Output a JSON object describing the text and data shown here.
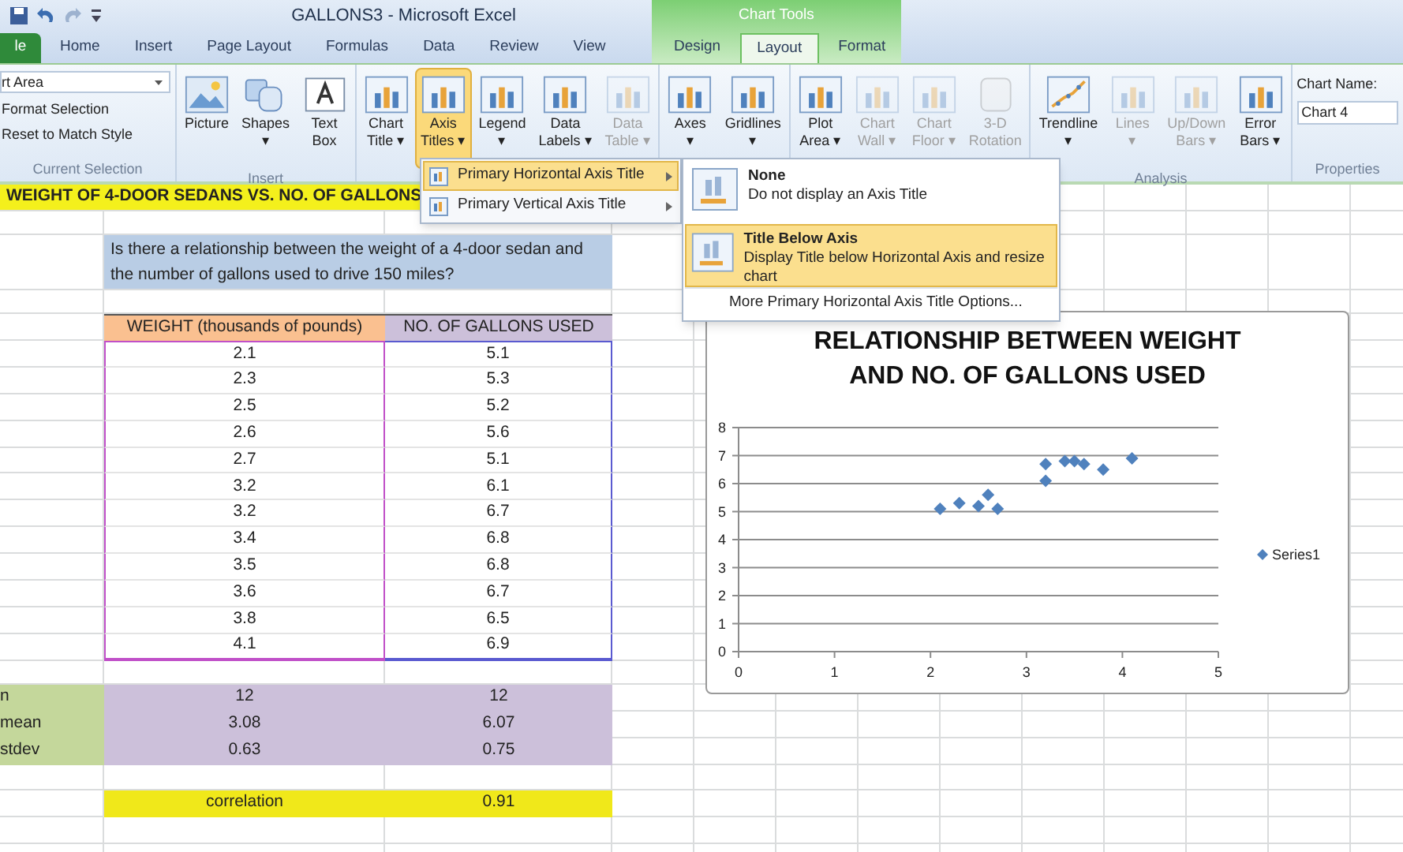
{
  "window": {
    "title": "GALLONS3 - Microsoft Excel",
    "context_header": "Chart Tools"
  },
  "tabs": [
    {
      "label": "le",
      "kind": "file",
      "selected": false
    },
    {
      "label": "Home",
      "kind": "tab",
      "selected": false
    },
    {
      "label": "Insert",
      "kind": "tab",
      "selected": false
    },
    {
      "label": "Page Layout",
      "kind": "tab",
      "selected": false
    },
    {
      "label": "Formulas",
      "kind": "tab",
      "selected": false
    },
    {
      "label": "Data",
      "kind": "tab",
      "selected": false
    },
    {
      "label": "Review",
      "kind": "tab",
      "selected": false
    },
    {
      "label": "View",
      "kind": "tab",
      "selected": false
    },
    {
      "label": "Design",
      "kind": "context",
      "selected": false
    },
    {
      "label": "Layout",
      "kind": "context",
      "selected": true
    },
    {
      "label": "Format",
      "kind": "context",
      "selected": false
    }
  ],
  "current_selection": {
    "field": "rt Area",
    "items": [
      "Format Selection",
      "Reset to Match Style"
    ],
    "label": "Current Selection"
  },
  "groups": [
    {
      "label": "Insert",
      "buttons": [
        {
          "lines": [
            "Picture"
          ],
          "kind": "picture",
          "disabled": false,
          "selected": false
        },
        {
          "lines": [
            "Shapes",
            "▾"
          ],
          "kind": "shapes",
          "disabled": false,
          "selected": false
        },
        {
          "lines": [
            "Text",
            "Box"
          ],
          "kind": "textbox",
          "disabled": false,
          "selected": false
        }
      ]
    },
    {
      "buttons": [
        {
          "lines": [
            "Chart",
            "Title ▾"
          ],
          "kind": "chart",
          "disabled": false,
          "selected": false
        },
        {
          "lines": [
            "Axis",
            "Titles ▾"
          ],
          "kind": "chart",
          "disabled": false,
          "selected": true
        },
        {
          "lines": [
            "Legend",
            "▾"
          ],
          "kind": "chart",
          "disabled": false,
          "selected": false
        },
        {
          "lines": [
            "Data",
            "Labels ▾"
          ],
          "kind": "chart",
          "disabled": false,
          "selected": false
        },
        {
          "lines": [
            "Data",
            "Table ▾"
          ],
          "kind": "chart",
          "disabled": true,
          "selected": false
        }
      ]
    },
    {
      "buttons": [
        {
          "lines": [
            "Axes",
            "▾"
          ],
          "kind": "chart",
          "disabled": false,
          "selected": false
        },
        {
          "lines": [
            "Gridlines",
            "▾"
          ],
          "kind": "chart",
          "disabled": false,
          "selected": false
        }
      ]
    },
    {
      "buttons": [
        {
          "lines": [
            "Plot",
            "Area ▾"
          ],
          "kind": "chart",
          "disabled": false,
          "selected": false
        },
        {
          "lines": [
            "Chart",
            "Wall ▾"
          ],
          "kind": "chart",
          "disabled": true,
          "selected": false
        },
        {
          "lines": [
            "Chart",
            "Floor ▾"
          ],
          "kind": "chart",
          "disabled": true,
          "selected": false
        },
        {
          "lines": [
            "3-D",
            "Rotation"
          ],
          "kind": "cube",
          "disabled": true,
          "selected": false
        }
      ]
    },
    {
      "label": "Analysis",
      "buttons": [
        {
          "lines": [
            "Trendline",
            "▾"
          ],
          "kind": "trend",
          "disabled": false,
          "selected": false
        },
        {
          "lines": [
            "Lines",
            "▾"
          ],
          "kind": "chart",
          "disabled": true,
          "selected": false
        },
        {
          "lines": [
            "Up/Down",
            "Bars ▾"
          ],
          "kind": "chart",
          "disabled": true,
          "selected": false
        },
        {
          "lines": [
            "Error",
            "Bars ▾"
          ],
          "kind": "chart",
          "disabled": false,
          "selected": false
        }
      ]
    }
  ],
  "properties": {
    "label": "Properties",
    "name_label": "Chart Name:",
    "name_value": "Chart 4"
  },
  "menu": {
    "items": [
      {
        "label": "Primary Horizontal Axis Title",
        "selected": true
      },
      {
        "label": "Primary Vertical Axis Title",
        "selected": false
      }
    ]
  },
  "submenu": {
    "items": [
      {
        "title": "None",
        "description": "Do not display an Axis Title",
        "selected": false
      },
      {
        "title": "Title Below Axis",
        "description": "Display Title below Horizontal Axis and resize chart",
        "selected": true
      }
    ],
    "more": "More Primary Horizontal Axis Title Options..."
  },
  "sheet": {
    "banner": "WEIGHT OF 4-DOOR SEDANS VS. NO. OF GALLONS",
    "question": "Is there a relationship between the weight of a 4-door sedan and the number of gallons used to drive 150 miles?",
    "columns": [
      "WEIGHT (thousands of pounds)",
      "NO. OF GALLONS USED"
    ],
    "rows": [
      {
        "weight": "2.1",
        "gallons": "5.1"
      },
      {
        "weight": "2.3",
        "gallons": "5.3"
      },
      {
        "weight": "2.5",
        "gallons": "5.2"
      },
      {
        "weight": "2.6",
        "gallons": "5.6"
      },
      {
        "weight": "2.7",
        "gallons": "5.1"
      },
      {
        "weight": "3.2",
        "gallons": "6.1"
      },
      {
        "weight": "3.2",
        "gallons": "6.7"
      },
      {
        "weight": "3.4",
        "gallons": "6.8"
      },
      {
        "weight": "3.5",
        "gallons": "6.8"
      },
      {
        "weight": "3.6",
        "gallons": "6.7"
      },
      {
        "weight": "3.8",
        "gallons": "6.5"
      },
      {
        "weight": "4.1",
        "gallons": "6.9"
      }
    ],
    "stats": [
      {
        "label": "n",
        "weight": "12",
        "gallons": "12"
      },
      {
        "label": "mean",
        "weight": "3.08",
        "gallons": "6.07"
      },
      {
        "label": "stdev",
        "weight": "0.63",
        "gallons": "0.75"
      }
    ],
    "correlation": {
      "label": "correlation",
      "value": "0.91"
    }
  },
  "chart": {
    "chart_data": {
      "type": "scatter",
      "title": "RELATIONSHIP BETWEEN WEIGHT AND NO. OF GALLONS USED",
      "grid": true,
      "x": [
        2.1,
        2.3,
        2.5,
        2.6,
        2.7,
        3.2,
        3.2,
        3.4,
        3.5,
        3.6,
        3.8,
        4.1
      ],
      "series": [
        {
          "name": "Series1",
          "color": "#4f81bd",
          "values": [
            5.1,
            5.3,
            5.2,
            5.6,
            5.1,
            6.1,
            6.7,
            6.8,
            6.8,
            6.7,
            6.5,
            6.9
          ]
        }
      ],
      "xlim": [
        0,
        5
      ],
      "ylim": [
        0,
        8
      ],
      "xticks": [
        0,
        1,
        2,
        3,
        4,
        5
      ],
      "yticks": [
        0,
        1,
        2,
        3,
        4,
        5,
        6,
        7,
        8
      ]
    }
  }
}
